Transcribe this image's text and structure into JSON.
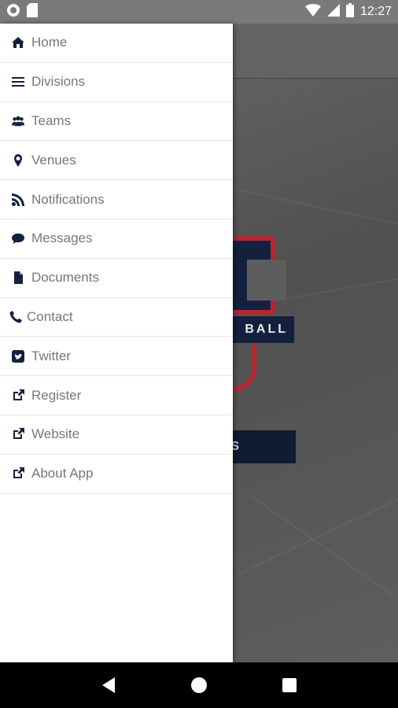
{
  "status_bar": {
    "time": "12:27",
    "icons": [
      "circle-notification-icon",
      "sim-card-icon",
      "wifi-icon",
      "signal-icon",
      "battery-icon"
    ]
  },
  "background_app": {
    "logo_banner_text": "BALL",
    "button_text": "S",
    "colors": {
      "navy": "#13213f",
      "red": "#b5262f"
    }
  },
  "drawer": {
    "items": [
      {
        "label": "Home",
        "icon": "home-icon"
      },
      {
        "label": "Divisions",
        "icon": "list-icon"
      },
      {
        "label": "Teams",
        "icon": "users-icon"
      },
      {
        "label": "Venues",
        "icon": "map-marker-icon"
      },
      {
        "label": "Notifications",
        "icon": "rss-icon"
      },
      {
        "label": "Messages",
        "icon": "comment-icon"
      },
      {
        "label": "Documents",
        "icon": "document-icon"
      },
      {
        "label": "Contact",
        "icon": "phone-icon"
      },
      {
        "label": "Twitter",
        "icon": "twitter-icon"
      },
      {
        "label": "Register",
        "icon": "external-link-icon"
      },
      {
        "label": "Website",
        "icon": "external-link-icon"
      },
      {
        "label": "About App",
        "icon": "external-link-icon"
      }
    ]
  },
  "nav_bar": {
    "buttons": [
      "back-icon",
      "home-circle-icon",
      "recents-icon"
    ]
  }
}
